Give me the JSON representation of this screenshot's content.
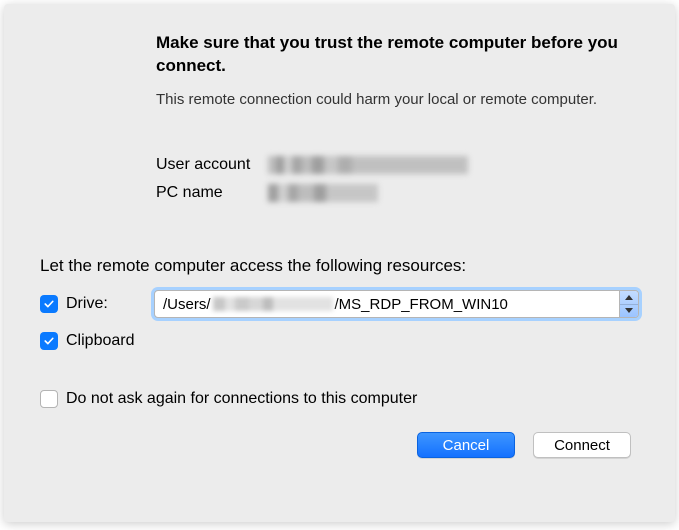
{
  "title": "Make sure that you trust the remote computer before you connect.",
  "subtitle": "This remote connection could harm your local or remote computer.",
  "info": {
    "user_account_label": "User account",
    "pc_name_label": "PC name"
  },
  "access_heading": "Let the remote computer access the following resources:",
  "options": {
    "drive_label": "Drive:",
    "drive_path_prefix": "/Users/",
    "drive_path_suffix": "/MS_RDP_FROM_WIN10",
    "drive_checked": true,
    "clipboard_label": "Clipboard",
    "clipboard_checked": true
  },
  "dont_ask": {
    "label": "Do not ask again for connections to this computer",
    "checked": false
  },
  "buttons": {
    "cancel": "Cancel",
    "connect": "Connect"
  }
}
